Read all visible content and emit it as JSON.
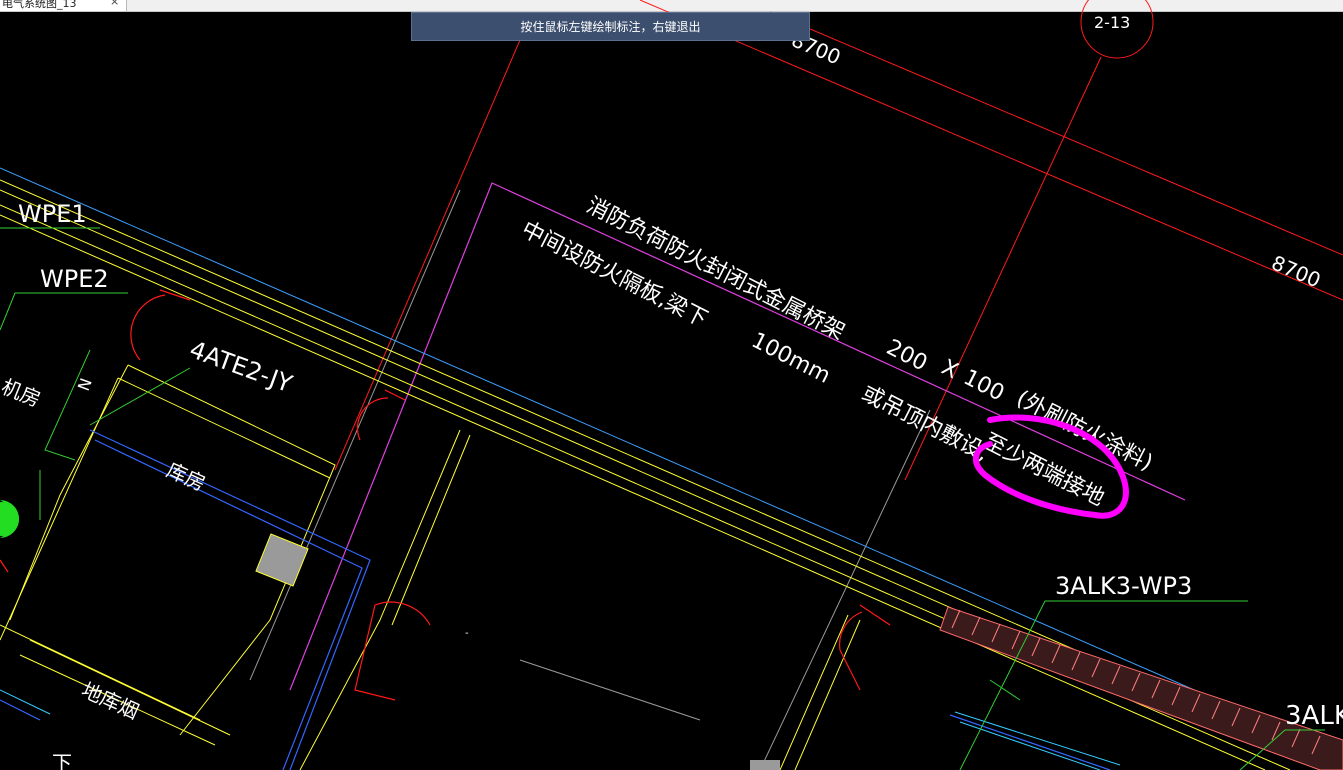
{
  "tab": {
    "title": "电气系统图_13",
    "close_glyph": "×"
  },
  "prompt": {
    "text": "按住鼠标左键绘制标注，右键退出"
  },
  "colors": {
    "background": "#000000",
    "prompt_bg": "#3c4f6e",
    "highlight": "#ff00ff",
    "axis": "#ff0000",
    "wall": "#ffff00",
    "conduit": "#00ff00"
  },
  "drawing": {
    "grid_bubble": "2-13",
    "dim_top": "8700",
    "dim_right": "8700",
    "labels": {
      "wpe1": "WPE1",
      "wpe2": "WPE2",
      "ate": "4ATE2-JY",
      "kufang": "库房",
      "jifang": "机房",
      "dikuyan": "地库烟",
      "xia": "下",
      "n": "N",
      "alk_wp3": "3ALK3-WP3",
      "alk_partial": "3ALK"
    },
    "note": {
      "line1": "消防负荷防火封闭式金属桥架",
      "line2": "中间设防火隔板,梁下",
      "mm": "100mm",
      "size_w": "200",
      "size_x": "X",
      "size_h": "100",
      "paint": "(外刷防火涂料)",
      "line3a": "或吊顶内敷设,",
      "line3b": "至少两端接地"
    }
  }
}
